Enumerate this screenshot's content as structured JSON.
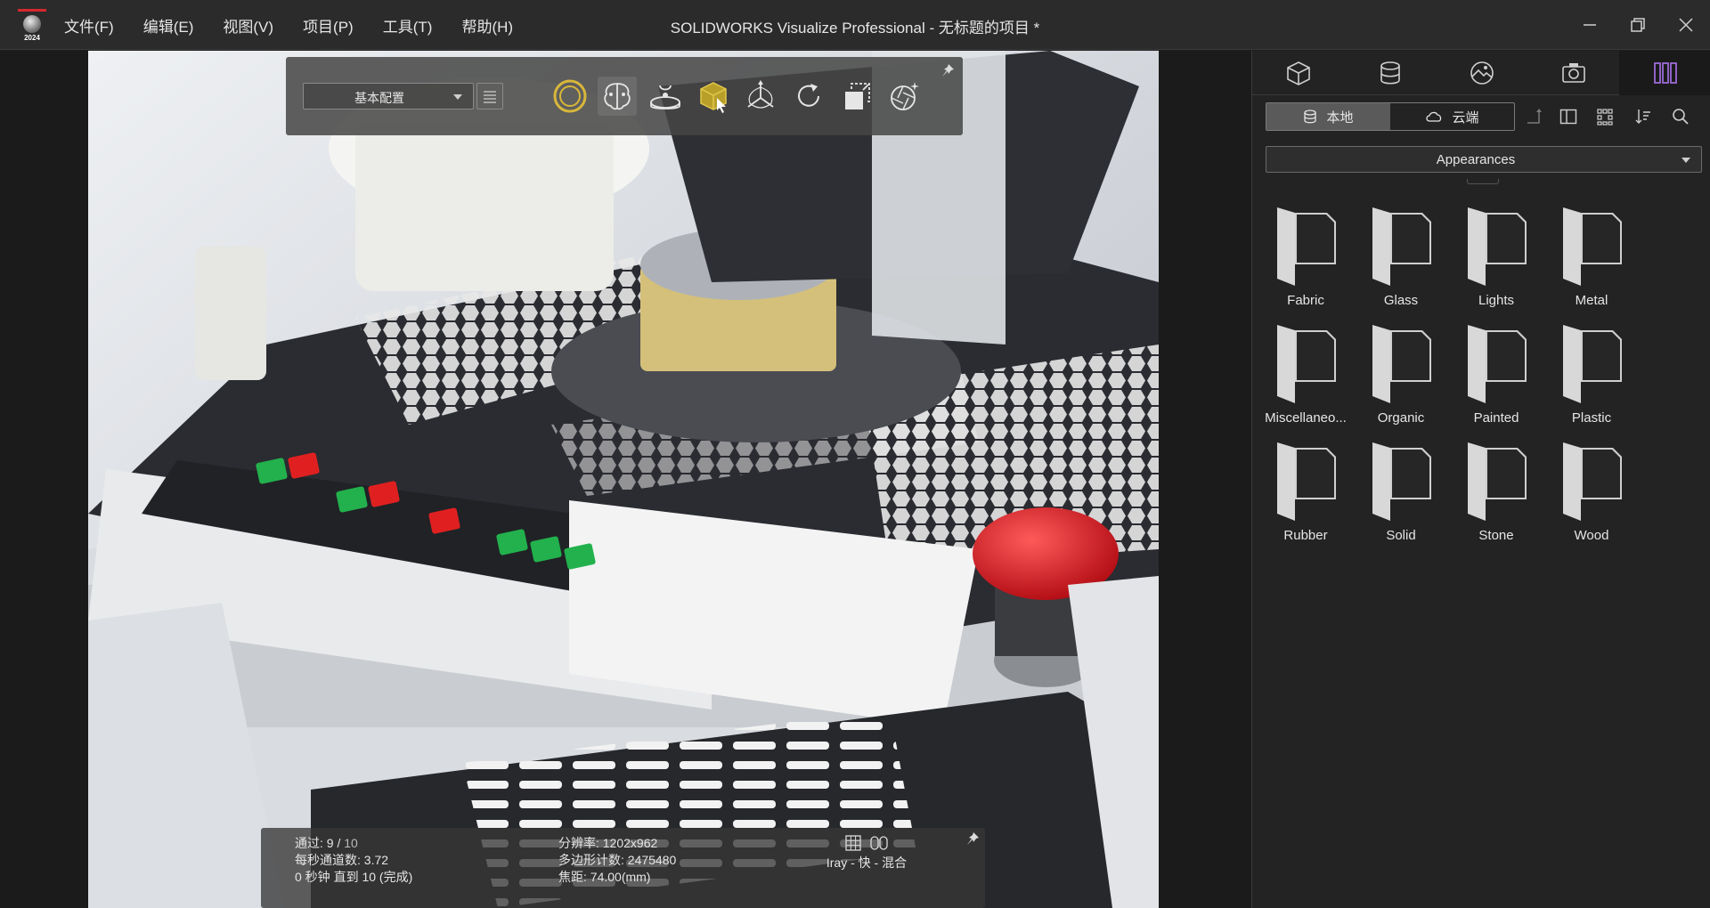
{
  "app": {
    "logo_year": "2024",
    "title": "SOLIDWORKS Visualize Professional - 无标题的项目 *"
  },
  "menu": [
    "文件(F)",
    "编辑(E)",
    "视图(V)",
    "项目(P)",
    "工具(T)",
    "帮助(H)"
  ],
  "toolbar": {
    "config_label": "基本配置",
    "icons": [
      "render-mode-icon",
      "denoiser-brain-icon",
      "turntable-icon",
      "select-model-icon",
      "transform-gizmo-icon",
      "rotate-icon",
      "model-set-icon",
      "auto-focus-icon"
    ]
  },
  "hud": {
    "passes_label": "通过:",
    "passes_current": "9 /",
    "passes_total": "10",
    "passes_per_sec": "每秒通道数: 3.72",
    "time": "0 秒钟 直到 10 (完成)",
    "resolution": "分辨率: 1202x962",
    "polygons": "多边形计数: 2475480",
    "focus": "焦距: 74.00(mm)",
    "render_mode": "Iray - 快 - 混合"
  },
  "panel": {
    "tabs": [
      "models-tab",
      "appearances-tab",
      "scenes-tab",
      "cameras-tab",
      "libraries-tab"
    ],
    "source_local": "本地",
    "source_cloud": "云端",
    "library_selected": "Appearances",
    "folders": [
      "Fabric",
      "Glass",
      "Lights",
      "Metal",
      "Miscellaneo...",
      "Organic",
      "Painted",
      "Plastic",
      "Rubber",
      "Solid",
      "Stone",
      "Wood"
    ]
  },
  "colors": {
    "accent_purple": "#9b6bd6",
    "brand_red": "#d7282f",
    "viewport_bg": "#1b1b1b"
  }
}
